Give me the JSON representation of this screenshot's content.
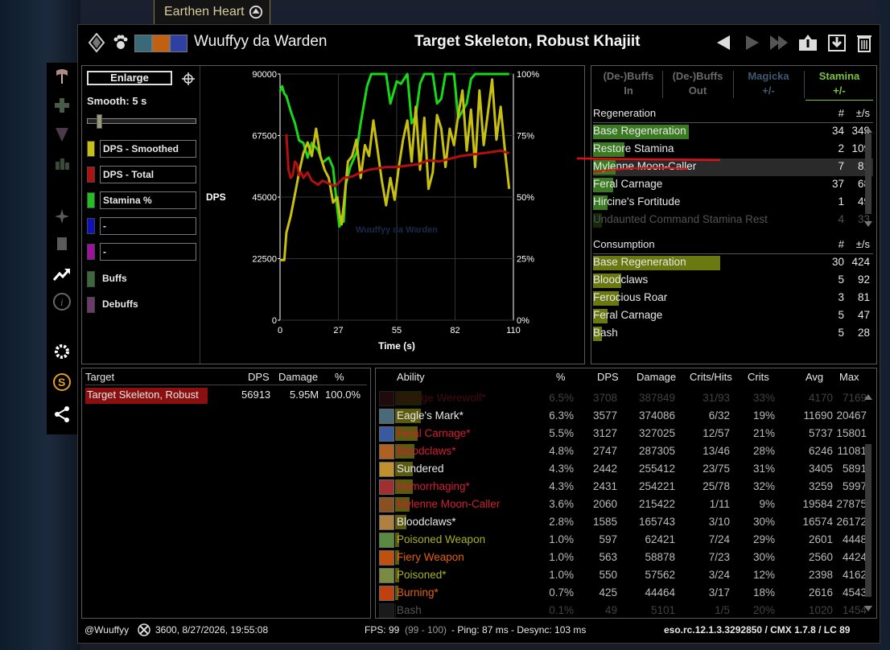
{
  "tooltip": {
    "text": "Earthen Heart"
  },
  "header": {
    "player_name": "Wuuffyy da Warden",
    "target_title": "Target Skeleton, Robust Khajiit"
  },
  "graph_panel": {
    "enlarge_label": "Enlarge",
    "smooth_label": "Smooth: 5 s",
    "legend": [
      {
        "label": "DPS - Smoothed",
        "color": "#c8c010"
      },
      {
        "label": "DPS - Total",
        "color": "#b01010"
      },
      {
        "label": "Stamina %",
        "color": "#20c020"
      },
      {
        "label": "-",
        "color": "#1010c0"
      },
      {
        "label": "-",
        "color": "#a010a0"
      },
      {
        "label": "Buffs",
        "color": "#3a6a3a"
      },
      {
        "label": "Debuffs",
        "color": "#6a3a6a"
      }
    ]
  },
  "chart_data": {
    "type": "line",
    "title": "",
    "watermark": "Wuuffyy da Warden",
    "xlabel": "Time (s)",
    "ylabel": "DPS",
    "xlim": [
      0,
      110
    ],
    "ylim": [
      0,
      90000
    ],
    "y2lim": [
      0,
      100
    ],
    "x_ticks": [
      "0",
      "27",
      "55",
      "82",
      "110"
    ],
    "y_ticks": [
      "0",
      "22500",
      "45000",
      "67500",
      "90000"
    ],
    "y2_ticks": [
      "0%",
      "25%",
      "50%",
      "75%",
      "100%"
    ],
    "series": [
      {
        "name": "Stamina %",
        "axis": "right",
        "color": "#18d818",
        "x": [
          0,
          1,
          2,
          3,
          5,
          7,
          9,
          11,
          13,
          15,
          18,
          20,
          23,
          25,
          27,
          28,
          29,
          30,
          31,
          33,
          36,
          38,
          40,
          41,
          43,
          46,
          48,
          50,
          52,
          55,
          57,
          60,
          62,
          64,
          66,
          68,
          70,
          72,
          74,
          76,
          78,
          80,
          82,
          84,
          86,
          88,
          90,
          92,
          94,
          97,
          100,
          103,
          106,
          108
        ],
        "y": [
          93,
          95,
          92,
          91,
          85,
          80,
          73,
          72,
          66,
          72,
          69,
          64,
          66,
          62,
          45,
          38,
          42,
          40,
          55,
          62,
          68,
          80,
          90,
          95,
          100,
          100,
          100,
          100,
          88,
          97,
          96,
          100,
          80,
          83,
          96,
          100,
          100,
          100,
          88,
          90,
          100,
          100,
          100,
          82,
          85,
          88,
          98,
          100,
          100,
          100,
          100,
          100,
          100,
          100
        ]
      },
      {
        "name": "DPS - Smoothed",
        "axis": "left",
        "color": "#c8c010",
        "x": [
          0,
          2,
          3,
          5,
          7,
          9,
          11,
          13,
          15,
          17,
          19,
          21,
          23,
          25,
          27,
          28,
          29,
          30,
          32,
          34,
          36,
          38,
          40,
          42,
          44,
          46,
          48,
          50,
          52,
          54,
          56,
          58,
          60,
          62,
          64,
          66,
          68,
          70,
          72,
          74,
          76,
          78,
          80,
          82,
          84,
          86,
          88,
          90,
          92,
          94,
          96,
          98,
          100,
          102,
          104,
          106,
          108
        ],
        "y": [
          22000,
          22000,
          32000,
          38000,
          46000,
          54000,
          61000,
          65000,
          60000,
          70000,
          60000,
          55000,
          52000,
          43000,
          45000,
          39000,
          35000,
          42000,
          58000,
          60000,
          66000,
          52000,
          64000,
          60000,
          73000,
          62000,
          51000,
          42000,
          52000,
          44000,
          56000,
          66000,
          73000,
          58000,
          78000,
          55000,
          74000,
          48000,
          54000,
          75000,
          70000,
          56000,
          70000,
          64000,
          75000,
          84000,
          62000,
          77000,
          56000,
          84000,
          64000,
          76000,
          88000,
          66000,
          78000,
          62000,
          48000
        ]
      },
      {
        "name": "DPS - Total",
        "axis": "left",
        "color": "#b01010",
        "x": [
          3,
          4,
          5,
          6,
          7,
          8,
          9,
          10,
          11,
          13,
          15,
          18,
          20,
          23,
          26,
          30,
          34,
          38,
          42,
          46,
          50,
          55,
          60,
          65,
          70,
          75,
          80,
          85,
          90,
          95,
          100,
          104,
          108
        ],
        "y": [
          68000,
          55000,
          52000,
          53000,
          58000,
          57000,
          53000,
          54000,
          52000,
          54000,
          51000,
          49500,
          51000,
          50000,
          49000,
          52000,
          52500,
          54000,
          55000,
          55500,
          56000,
          56000,
          56500,
          57000,
          58500,
          58000,
          59000,
          60000,
          60500,
          61000,
          61500,
          62000,
          61000
        ]
      }
    ]
  },
  "regen_panel": {
    "tabs": [
      "(De-)Buffs\nIn",
      "(De-)Buffs\nOut",
      "Magicka\n+/-",
      "Stamina\n+/-"
    ],
    "active_tab": "Stamina",
    "regeneration": {
      "header": {
        "name": "Regeneration",
        "count": "#",
        "rate": "±/s"
      },
      "rows": [
        {
          "name": "Base Regeneration",
          "count": "34",
          "rate": "349",
          "bar": 0.34
        },
        {
          "name": "Restore Stamina",
          "count": "2",
          "rate": "109",
          "bar": 0.11
        },
        {
          "name": "Mylenne Moon-Caller",
          "count": "7",
          "rate": "81",
          "bar": 0.08,
          "highlight": true
        },
        {
          "name": "Feral Carnage",
          "count": "37",
          "rate": "68",
          "bar": 0.07
        },
        {
          "name": "Hircine's Fortitude",
          "count": "1",
          "rate": "49",
          "bar": 0.05
        },
        {
          "name": "Undaunted Command Stamina Rest",
          "count": "4",
          "rate": "33",
          "bar": 0.03,
          "faded": true
        }
      ]
    },
    "consumption": {
      "header": {
        "name": "Consumption",
        "count": "#",
        "rate": "±/s"
      },
      "rows": [
        {
          "name": "Base Regeneration",
          "count": "30",
          "rate": "424",
          "bar": 0.45
        },
        {
          "name": "Bloodclaws",
          "count": "5",
          "rate": "92",
          "bar": 0.1
        },
        {
          "name": "Ferocious Roar",
          "count": "3",
          "rate": "81",
          "bar": 0.09
        },
        {
          "name": "Feral Carnage",
          "count": "5",
          "rate": "47",
          "bar": 0.05
        },
        {
          "name": "Bash",
          "count": "5",
          "rate": "28",
          "bar": 0.03
        }
      ]
    }
  },
  "target_panel": {
    "headers": {
      "target": "Target",
      "dps": "DPS",
      "damage": "Damage",
      "pct": "%"
    },
    "rows": [
      {
        "target": "Target Skeleton, Robust",
        "dps": "56913",
        "damage": "5.95M",
        "pct": "100.0%"
      }
    ]
  },
  "ability_panel": {
    "headers": {
      "ability": "Ability",
      "pct": "%",
      "dps": "DPS",
      "damage": "Damage",
      "crits_hits": "Crits/Hits",
      "crits": "Crits",
      "avg": "Avg",
      "max": "Max"
    },
    "rows": [
      {
        "ability": "Savage Werewolf*",
        "pct": "6.5%",
        "dps": "3708",
        "damage": "387849",
        "crits_hits": "31/93",
        "crits": "33%",
        "avg": "4170",
        "max": "7169",
        "color": "#c02030",
        "faded": true,
        "icon_color": "#5a2020"
      },
      {
        "ability": "Eagle's Mark*",
        "pct": "6.3%",
        "dps": "3577",
        "damage": "374086",
        "crits_hits": "6/32",
        "crits": "19%",
        "avg": "11690",
        "max": "20467",
        "color": "#e8e8e8",
        "icon_color": "#4a6a7a"
      },
      {
        "ability": "Feral Carnage*",
        "pct": "5.5%",
        "dps": "3127",
        "damage": "327025",
        "crits_hits": "12/57",
        "crits": "21%",
        "avg": "5737",
        "max": "15801",
        "color": "#d02030",
        "icon_color": "#3a5aa0"
      },
      {
        "ability": "Bloodclaws*",
        "pct": "4.8%",
        "dps": "2747",
        "damage": "287305",
        "crits_hits": "13/46",
        "crits": "28%",
        "avg": "6246",
        "max": "11081",
        "color": "#d02030",
        "icon_color": "#b06020"
      },
      {
        "ability": "Sundered",
        "pct": "4.3%",
        "dps": "2442",
        "damage": "255412",
        "crits_hits": "23/75",
        "crits": "31%",
        "avg": "3405",
        "max": "5891",
        "color": "#e8e8e8",
        "icon_color": "#c09030"
      },
      {
        "ability": "Hemorrhaging*",
        "pct": "4.3%",
        "dps": "2431",
        "damage": "254221",
        "crits_hits": "25/78",
        "crits": "32%",
        "avg": "3259",
        "max": "5997",
        "color": "#d02030",
        "icon_color": "#a03030"
      },
      {
        "ability": "Mylenne Moon-Caller",
        "pct": "3.6%",
        "dps": "2060",
        "damage": "215422",
        "crits_hits": "1/11",
        "crits": "9%",
        "avg": "19584",
        "max": "27875",
        "color": "#d02030",
        "icon_color": "#8a5020"
      },
      {
        "ability": "Bloodclaws*",
        "pct": "2.8%",
        "dps": "1585",
        "damage": "165743",
        "crits_hits": "3/10",
        "crits": "30%",
        "avg": "16574",
        "max": "26172",
        "color": "#e8e8e8",
        "icon_color": "#b08040"
      },
      {
        "ability": "Poisoned Weapon",
        "pct": "1.0%",
        "dps": "597",
        "damage": "62421",
        "crits_hits": "7/24",
        "crits": "29%",
        "avg": "2601",
        "max": "4448",
        "color": "#a8b020",
        "icon_color": "#5a8a40"
      },
      {
        "ability": "Fiery Weapon",
        "pct": "1.0%",
        "dps": "563",
        "damage": "58878",
        "crits_hits": "7/23",
        "crits": "30%",
        "avg": "2560",
        "max": "4424",
        "color": "#e06010",
        "icon_color": "#c05010"
      },
      {
        "ability": "Poisoned*",
        "pct": "1.0%",
        "dps": "550",
        "damage": "57562",
        "crits_hits": "3/24",
        "crits": "12%",
        "avg": "2398",
        "max": "4162",
        "color": "#a8b020",
        "icon_color": "#7a8a40"
      },
      {
        "ability": "Burning*",
        "pct": "0.7%",
        "dps": "425",
        "damage": "44464",
        "crits_hits": "3/17",
        "crits": "18%",
        "avg": "2616",
        "max": "4543",
        "color": "#e06010",
        "icon_color": "#c04010"
      },
      {
        "ability": "Bash",
        "pct": "0.1%",
        "dps": "49",
        "damage": "5101",
        "crits_hits": "1/5",
        "crits": "20%",
        "avg": "1020",
        "max": "1454",
        "color": "#e8e8e8",
        "faded": true,
        "icon_color": "#4a4a4a"
      }
    ]
  },
  "footer": {
    "account": "@Wuuffyy",
    "cp_and_time": "3600, 8/27/2026, 19:55:08",
    "fps_label": "FPS: 99",
    "fps_range": "(99 - 100)",
    "net": "- Ping: 87 ms - Desync: 103 ms",
    "version": "eso.rc.12.1.3.3292850 / CMX 1.7.8 / LC 89"
  },
  "colors": {
    "panel_border": "#5a5a5a",
    "stamina_accent": "#7ec23e",
    "damage_bar": "#8a1010",
    "regen_bar": "#3a7a20",
    "consume_bar": "#6a7a10"
  }
}
